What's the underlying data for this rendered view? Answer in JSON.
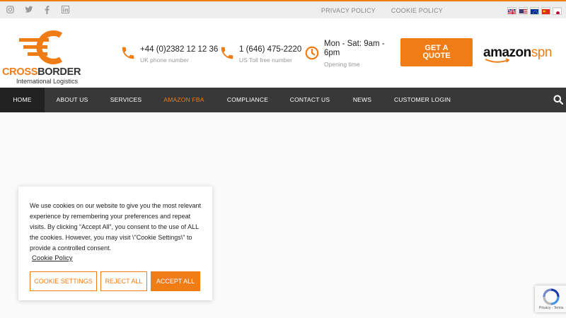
{
  "topbar": {
    "social_icons": [
      "instagram-icon",
      "twitter-icon",
      "facebook-icon",
      "linkedin-icon"
    ],
    "privacy_label": "PRIVACY POLICY",
    "cookie_label": "COOKIE POLICY",
    "flags": [
      "uk-flag",
      "us-flag",
      "eu-flag",
      "china-flag",
      "japan-flag"
    ]
  },
  "logo": {
    "name_part1": "CROSS",
    "name_part2": "BORDER",
    "subtitle": "International Logistics"
  },
  "contacts": [
    {
      "main": "+44 (0)2382 12 12 36",
      "sub": "UK phone number",
      "icon": "phone-icon"
    },
    {
      "main": "1 (646) 475-2220",
      "sub": "US Toll free number",
      "icon": "phone-icon"
    },
    {
      "main_line1": "Mon - Sat: 9am -",
      "main_line2": "6pm",
      "sub": "Opening time",
      "icon": "clock-icon"
    }
  ],
  "quote_button": {
    "line1": "GET A",
    "line2": "QUOTE"
  },
  "amazon": {
    "word": "amazon",
    "suffix": "spn"
  },
  "nav": {
    "items": [
      "HOME",
      "ABOUT US",
      "SERVICES",
      "AMAZON FBA",
      "COMPLIANCE",
      "CONTACT US",
      "NEWS",
      "CUSTOMER LOGIN"
    ],
    "active": "HOME",
    "highlight": "AMAZON FBA"
  },
  "cookie": {
    "text": "We use cookies on our website to give you the most relevant experience by remembering your preferences and repeat visits. By clicking “Accept All”, you consent to the use of ALL the cookies. However, you may visit \\\"Cookie Settings\\\" to provide a controlled consent.",
    "link_label": "Cookie Policy",
    "settings_label": "COOKIE SETTINGS",
    "reject_label": "REJECT ALL",
    "accept_label": "ACCEPT ALL"
  },
  "recaptcha": {
    "terms": "Privacy - Terms"
  },
  "colors": {
    "accent": "#f07c16",
    "nav_bg": "#383838"
  }
}
